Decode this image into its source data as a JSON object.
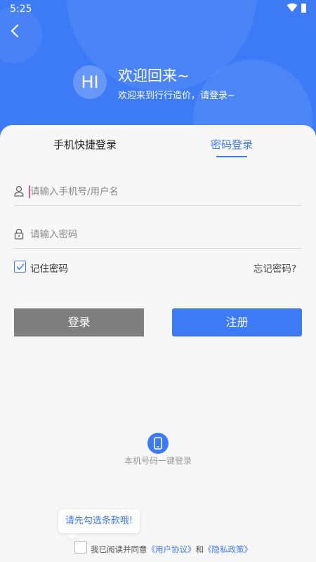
{
  "statusbar": {
    "time": "5:25"
  },
  "header": {
    "avatar_text": "HI",
    "welcome_title": "欢迎回来~",
    "welcome_subtitle": "欢迎来到行行造价，请登录~"
  },
  "tabs": {
    "phone_login": "手机快捷登录",
    "password_login": "密码登录",
    "active": "password_login"
  },
  "form": {
    "username_placeholder": "请输入手机号/用户名",
    "username_value": "",
    "password_placeholder": "请输入密码",
    "password_value": "",
    "remember_label": "记住密码",
    "remember_checked": true,
    "forgot_label": "忘记密码?"
  },
  "buttons": {
    "login": "登录",
    "register": "注册"
  },
  "one_key": {
    "label": "本机号码一键登录"
  },
  "agreement": {
    "tooltip": "请先勾选条款哦!",
    "prefix": "我已阅读并同意",
    "user_agreement": "《用户协议》",
    "conjunction": "和",
    "privacy_policy": "《隐私政策》",
    "checked": false
  },
  "colors": {
    "primary": "#3d7bf6",
    "login_button": "#7f7f7f",
    "background": "#f7f7f7"
  }
}
